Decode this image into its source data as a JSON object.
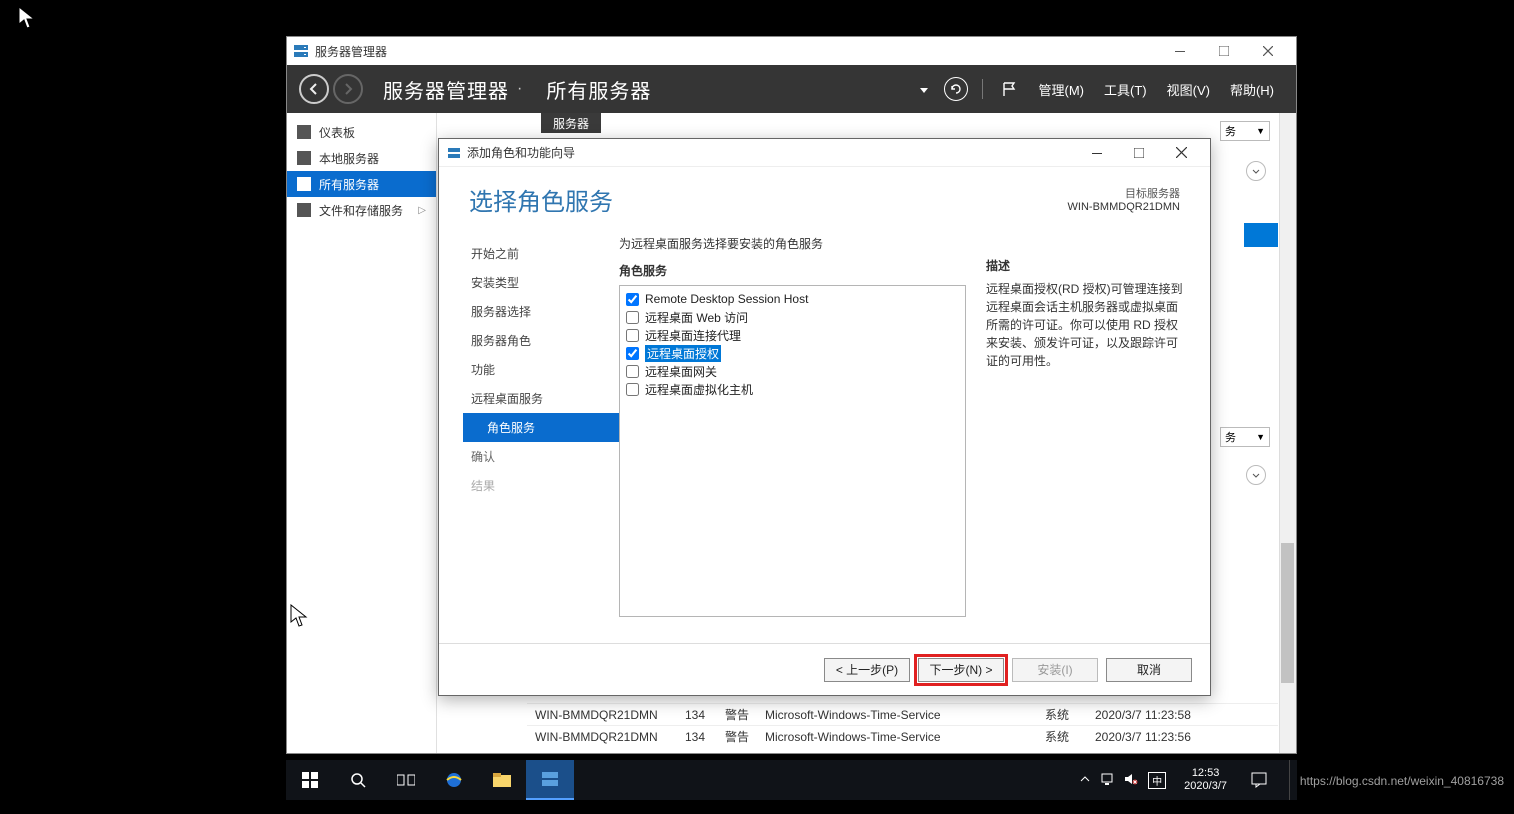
{
  "outer_window": {
    "title": "服务器管理器"
  },
  "header": {
    "app_name": "服务器管理器",
    "breadcrumb_separator": "·",
    "breadcrumb_page": "所有服务器",
    "menu_manage": "管理(M)",
    "menu_tools": "工具(T)",
    "menu_view": "视图(V)",
    "menu_help": "帮助(H)"
  },
  "nav": {
    "items": [
      {
        "label": "仪表板"
      },
      {
        "label": "本地服务器"
      },
      {
        "label": "所有服务器"
      },
      {
        "label": "文件和存储服务"
      }
    ]
  },
  "right": {
    "tab_label": "服务器",
    "task_label": "务",
    "events": [
      {
        "server": "WIN-BMMDQR21DMN",
        "id": "134",
        "severity": "警告",
        "source": "Microsoft-Windows-Time-Service",
        "log": "系统",
        "timestamp": "2020/3/7 11:23:58"
      },
      {
        "server": "WIN-BMMDQR21DMN",
        "id": "134",
        "severity": "警告",
        "source": "Microsoft-Windows-Time-Service",
        "log": "系统",
        "timestamp": "2020/3/7 11:23:56"
      }
    ]
  },
  "wizard": {
    "title": "添加角色和功能向导",
    "heading": "选择角色服务",
    "target_label": "目标服务器",
    "target_value": "WIN-BMMDQR21DMN",
    "lead": "为远程桌面服务选择要安装的角色服务",
    "steps": [
      {
        "label": "开始之前",
        "type": "done"
      },
      {
        "label": "安装类型",
        "type": "done"
      },
      {
        "label": "服务器选择",
        "type": "done"
      },
      {
        "label": "服务器角色",
        "type": "done"
      },
      {
        "label": "功能",
        "type": "done"
      },
      {
        "label": "远程桌面服务",
        "type": "done"
      },
      {
        "label": "角色服务",
        "type": "active",
        "sub": true
      },
      {
        "label": "确认",
        "type": "pending"
      },
      {
        "label": "结果",
        "type": "disabled"
      }
    ],
    "roles_label": "角色服务",
    "roles": [
      {
        "label": "Remote Desktop Session Host",
        "checked": true
      },
      {
        "label": "远程桌面 Web 访问",
        "checked": false
      },
      {
        "label": "远程桌面连接代理",
        "checked": false
      },
      {
        "label": "远程桌面授权",
        "checked": true,
        "selected": true
      },
      {
        "label": "远程桌面网关",
        "checked": false
      },
      {
        "label": "远程桌面虚拟化主机",
        "checked": false
      }
    ],
    "desc_label": "描述",
    "desc_text": "远程桌面授权(RD 授权)可管理连接到远程桌面会话主机服务器或虚拟桌面所需的许可证。你可以使用 RD 授权来安装、颁发许可证，以及跟踪许可证的可用性。",
    "buttons": {
      "prev": "< 上一步(P)",
      "next": "下一步(N) >",
      "install": "安装(I)",
      "cancel": "取消"
    }
  },
  "taskbar": {
    "ime": "中",
    "time": "12:53",
    "date": "2020/3/7"
  },
  "watermark": "https://blog.csdn.net/weixin_40816738"
}
